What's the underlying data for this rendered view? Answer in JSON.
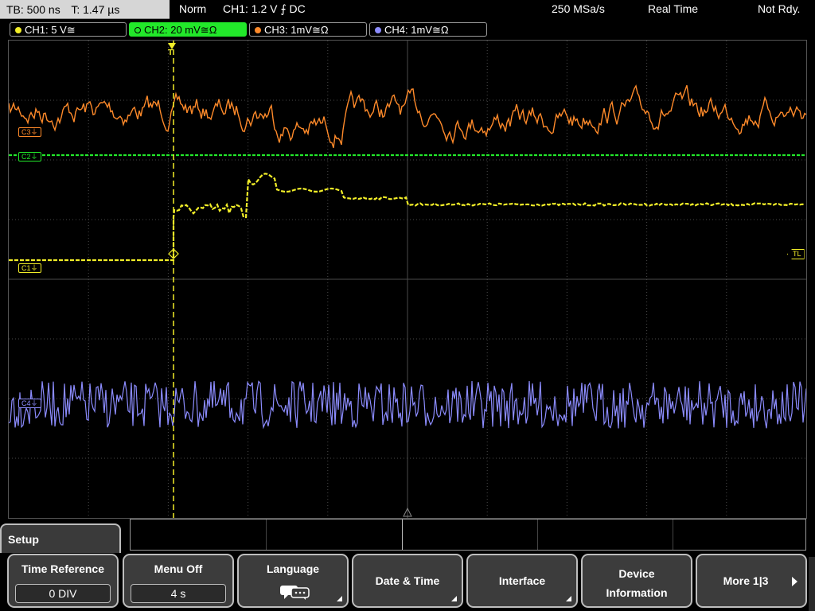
{
  "status": {
    "timebase": "TB: 500 ns",
    "trigger_time": "T: 1.47 µs",
    "mode": "Norm",
    "trigger_info": "CH1: 1.2 V ⨍ DC",
    "sample_rate": "250 MSa/s",
    "acq_mode": "Real Time",
    "state": "Not Rdy."
  },
  "channels": [
    {
      "label": "CH1: 5 V≅",
      "color": "#f2ee28",
      "active": false
    },
    {
      "label": "CH2: 20 mV≅Ω",
      "color": "#22e82a",
      "active": true
    },
    {
      "label": "CH3: 1mV≅Ω",
      "color": "#ff8a2a",
      "active": false
    },
    {
      "label": "CH4: 1mV≅Ω",
      "color": "#8c8cff",
      "active": false
    }
  ],
  "markers": {
    "c3": "C3⏚",
    "c2": "C2⏚",
    "c1": "C1⏚",
    "c4": "C4⏚",
    "trigger_level": "TL",
    "trigger_pos": "T"
  },
  "menu": {
    "title": "Setup",
    "time_reference": {
      "label": "Time Reference",
      "value": "0 DIV"
    },
    "menu_off": {
      "label": "Menu Off",
      "value": "4 s"
    },
    "language": {
      "label": "Language"
    },
    "date_time": {
      "label": "Date & Time"
    },
    "interface": {
      "label": "Interface"
    },
    "device_info": {
      "line1": "Device",
      "line2": "Information"
    },
    "more": {
      "label": "More 1|3"
    }
  },
  "colors": {
    "ch1": "#f2ee28",
    "ch2": "#22e82a",
    "ch3": "#ff8a2a",
    "ch4": "#8c8cff",
    "grid": "#4a4a4a"
  }
}
